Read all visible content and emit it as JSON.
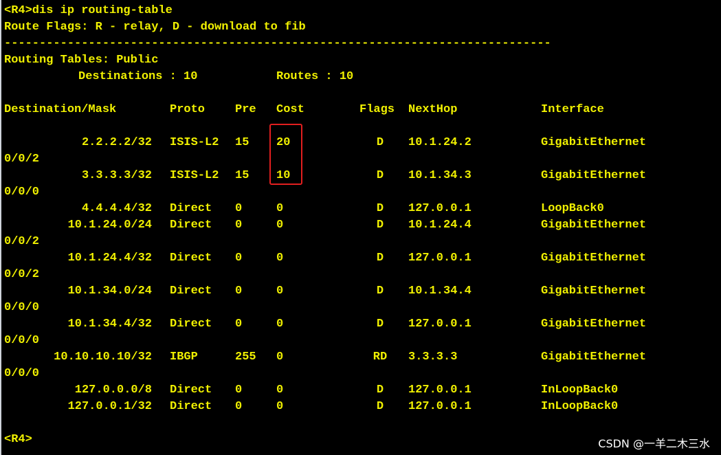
{
  "terminal": {
    "command_line": "<R4>dis ip routing-table",
    "route_flags": "Route Flags: R - relay, D - download to fib",
    "separator": "------------------------------------------------------------------------------",
    "table_heading": "Routing Tables: Public",
    "destinations_label": "Destinations : 10",
    "routes_label": "Routes : 10",
    "columns": [
      "Destination/Mask",
      "Proto",
      "Pre",
      "Cost",
      "Flags",
      "NextHop",
      "Interface"
    ],
    "rows": [
      {
        "dest": "2.2.2.2/32",
        "proto": "ISIS-L2",
        "pre": "15",
        "cost": "20",
        "flags": "D",
        "nexthop": "10.1.24.2",
        "iface": "GigabitEthernet",
        "iface_cont": "0/0/2"
      },
      {
        "dest": "3.3.3.3/32",
        "proto": "ISIS-L2",
        "pre": "15",
        "cost": "10",
        "flags": "D",
        "nexthop": "10.1.34.3",
        "iface": "GigabitEthernet",
        "iface_cont": "0/0/0"
      },
      {
        "dest": "4.4.4.4/32",
        "proto": "Direct",
        "pre": "0",
        "cost": "0",
        "flags": "D",
        "nexthop": "127.0.0.1",
        "iface": "LoopBack0",
        "iface_cont": ""
      },
      {
        "dest": "10.1.24.0/24",
        "proto": "Direct",
        "pre": "0",
        "cost": "0",
        "flags": "D",
        "nexthop": "10.1.24.4",
        "iface": "GigabitEthernet",
        "iface_cont": "0/0/2"
      },
      {
        "dest": "10.1.24.4/32",
        "proto": "Direct",
        "pre": "0",
        "cost": "0",
        "flags": "D",
        "nexthop": "127.0.0.1",
        "iface": "GigabitEthernet",
        "iface_cont": "0/0/2"
      },
      {
        "dest": "10.1.34.0/24",
        "proto": "Direct",
        "pre": "0",
        "cost": "0",
        "flags": "D",
        "nexthop": "10.1.34.4",
        "iface": "GigabitEthernet",
        "iface_cont": "0/0/0"
      },
      {
        "dest": "10.1.34.4/32",
        "proto": "Direct",
        "pre": "0",
        "cost": "0",
        "flags": "D",
        "nexthop": "127.0.0.1",
        "iface": "GigabitEthernet",
        "iface_cont": "0/0/0"
      },
      {
        "dest": "10.10.10.10/32",
        "proto": "IBGP",
        "pre": "255",
        "cost": "0",
        "flags": "RD",
        "nexthop": "3.3.3.3",
        "iface": "GigabitEthernet",
        "iface_cont": "0/0/0"
      },
      {
        "dest": "127.0.0.0/8",
        "proto": "Direct",
        "pre": "0",
        "cost": "0",
        "flags": "D",
        "nexthop": "127.0.0.1",
        "iface": "InLoopBack0",
        "iface_cont": ""
      },
      {
        "dest": "127.0.0.1/32",
        "proto": "Direct",
        "pre": "0",
        "cost": "0",
        "flags": "D",
        "nexthop": "127.0.0.1",
        "iface": "InLoopBack0",
        "iface_cont": ""
      }
    ],
    "prompt": "<R4>"
  },
  "watermark": "CSDN @一羊二木三水",
  "colors": {
    "background": "#000000",
    "text": "#f0f000",
    "highlight_box": "#e21f1f",
    "watermark": "#ffffff"
  }
}
